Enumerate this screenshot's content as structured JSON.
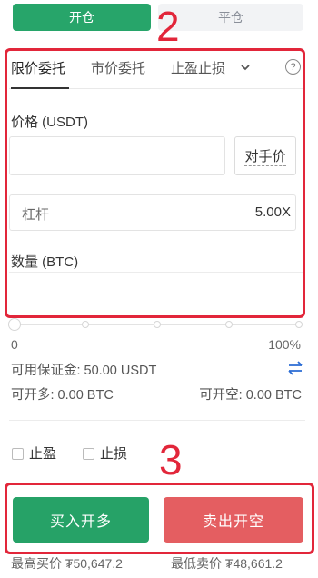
{
  "toggle": {
    "open": "开仓",
    "close": "平仓"
  },
  "tabs": {
    "limit": "限价委托",
    "market": "市价委托",
    "tpsl": "止盈止损"
  },
  "help": "?",
  "price": {
    "label": "价格 (USDT)",
    "value": "",
    "counter_button": "对手价"
  },
  "leverage": {
    "label": "杠杆",
    "value": "5.00X"
  },
  "quantity": {
    "label": "数量 (BTC)",
    "value": ""
  },
  "slider": {
    "min_label": "0",
    "max_label": "100%",
    "value_fraction": 0
  },
  "available": "可用保证金: 50.00 USDT",
  "can_long": "可开多: 0.00 BTC",
  "can_short": "可开空: 0.00 BTC",
  "checkboxes": {
    "take_profit": "止盈",
    "stop_loss": "止损"
  },
  "buttons": {
    "buy_long": "买入开多",
    "sell_short": "卖出开空"
  },
  "quotes": {
    "high_bid": "最高买价 ₮50,647.2",
    "low_ask": "最低卖价 ₮48,661.2"
  },
  "annotations": {
    "one": "2",
    "two": "3"
  },
  "colors": {
    "green": "#26a267",
    "red": "#e45e61",
    "annotation": "#e2263a"
  }
}
